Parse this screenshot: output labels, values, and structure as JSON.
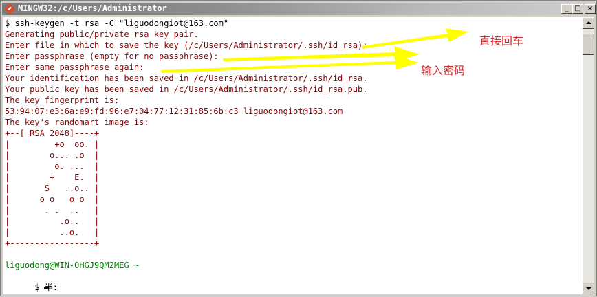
{
  "window": {
    "title": "MINGW32:/c/Users/Administrator",
    "buttons": {
      "minimize": "_",
      "maximize": "□",
      "close": "×"
    }
  },
  "terminal": {
    "lines": [
      "$ ssh-keygen -t rsa -C \"liguodongiot@163.com\"",
      "Generating public/private rsa key pair.",
      "Enter file in which to save the key (/c/Users/Administrator/.ssh/id_rsa):",
      "Enter passphrase (empty for no passphrase):",
      "Enter same passphrase again:",
      "Your identification has been saved in /c/Users/Administrator/.ssh/id_rsa.",
      "Your public key has been saved in /c/Users/Administrator/.ssh/id_rsa.pub.",
      "The key fingerprint is:",
      "53:94:07:e3:6a:e9:fd:96:e7:04:77:12:31:85:6b:c3 liguodongiot@163.com",
      "The key's randomart image is:",
      "+--[ RSA 2048]----+",
      "|         +o  oo. |",
      "|        o... .o  |",
      "|         o. ...  |",
      "|        +    E.  |",
      "|       S   ..o.. |",
      "|      o o   o o  |",
      "|       . .  ..   |",
      "|          .o..   |",
      "|          ..o.   |",
      "+-----------------+",
      "",
      "liguodong@WIN-OHGJ9QM2MEG ~",
      "$",
      "        半:"
    ]
  },
  "annotations": {
    "press_enter": "直接回车",
    "enter_password": "输入密码"
  },
  "colors": {
    "output_text": "#8b0000",
    "command_text": "#000000",
    "prompt_green": "#008000",
    "arrow_yellow": "#ffff00",
    "annotation_red": "#d12a2a"
  }
}
